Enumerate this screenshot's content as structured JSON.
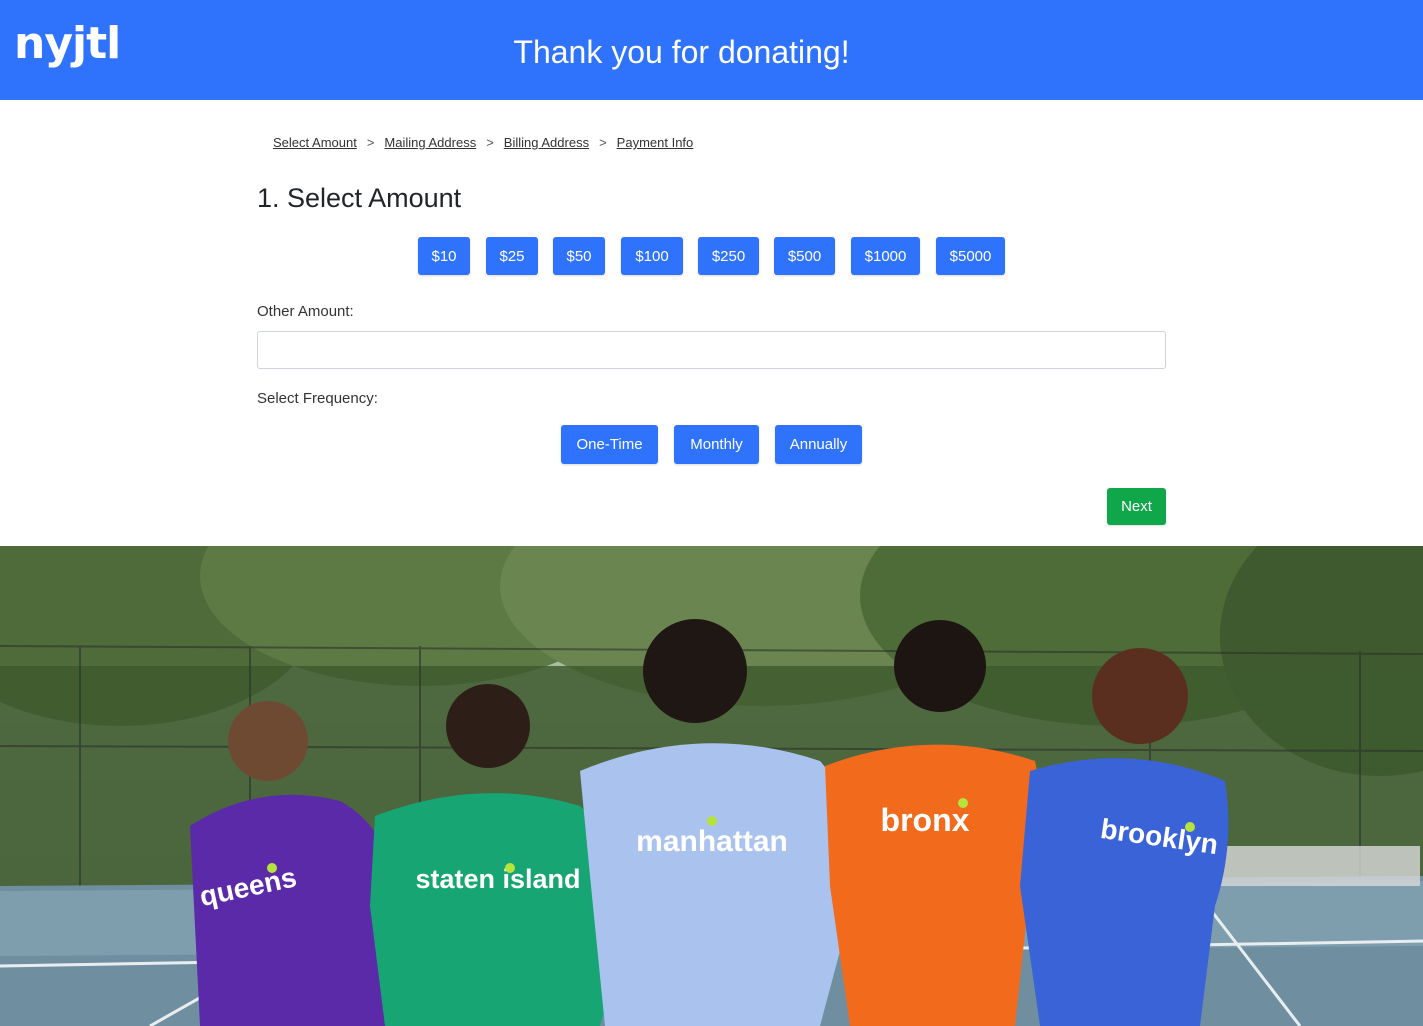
{
  "header": {
    "logo": "nyjtl",
    "title": "Thank you for donating!"
  },
  "breadcrumb": [
    {
      "label": "Select Amount"
    },
    {
      "label": "Mailing Address"
    },
    {
      "label": "Billing Address"
    },
    {
      "label": "Payment Info"
    }
  ],
  "breadcrumb_separator": ">",
  "section_title": "1. Select Amount",
  "amounts": [
    "$10",
    "$25",
    "$50",
    "$100",
    "$250",
    "$500",
    "$1000",
    "$5000"
  ],
  "other_amount": {
    "label": "Other Amount:",
    "value": ""
  },
  "frequency": {
    "label": "Select Frequency:",
    "options": [
      "One-Time",
      "Monthly",
      "Annually"
    ]
  },
  "next_label": "Next",
  "photo": {
    "shirts": [
      {
        "text": "queens",
        "color": "#5a2aa8"
      },
      {
        "text": "staten island",
        "color": "#17a673"
      },
      {
        "text": "manhattan",
        "color": "#a9c3ee"
      },
      {
        "text": "bronx",
        "color": "#f26b1d"
      },
      {
        "text": "brooklyn",
        "color": "#3b63d8"
      }
    ]
  },
  "colors": {
    "primary": "#2f73fc",
    "success": "#10a64a"
  }
}
